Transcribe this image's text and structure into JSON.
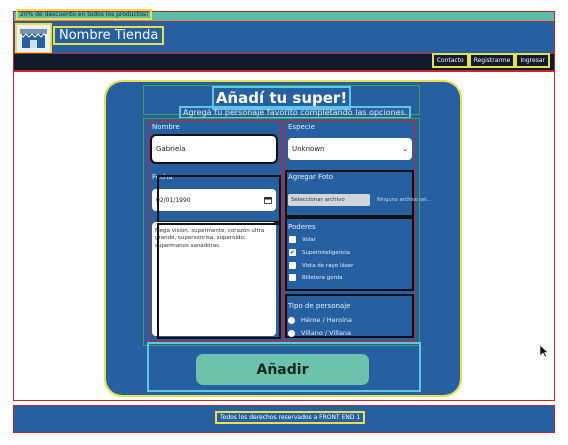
{
  "promo": {
    "text": "20% de descuento en todos los productos!"
  },
  "header": {
    "store_name": "Nombre Tienda",
    "logo_icon": "storefront-icon",
    "nav": [
      "Contacto",
      "Registrarme",
      "Ingresar"
    ]
  },
  "form": {
    "title": "Añadí tu super!",
    "subtitle": "Agregá tu personaje favorito completando las opciones.",
    "name": {
      "label": "Nombre",
      "value": "Gabriela"
    },
    "species": {
      "label": "Especie",
      "value": "Unknown"
    },
    "date": {
      "label": "Fecha",
      "value": "02/01/1990"
    },
    "photo": {
      "label": "Agregar Foto",
      "button": "Seleccionar archivo",
      "file_status": "Ninguno archivo sel..."
    },
    "description": "Mega visión, supermente, corazón ultra grande, supersonrisa, superoído, supermanos sanadoras.",
    "powers": {
      "label": "Poderes",
      "items": [
        {
          "label": "Volar",
          "checked": false
        },
        {
          "label": "Superinteligencia",
          "checked": true
        },
        {
          "label": "Vista de rayo láser",
          "checked": false
        },
        {
          "label": "Billetera gorda",
          "checked": false
        }
      ]
    },
    "character_type": {
      "label": "Tipo de personaje",
      "options": [
        {
          "label": "Héroe / Heroína",
          "selected": true
        },
        {
          "label": "Villano / Villana",
          "selected": false
        }
      ]
    },
    "submit": "Añadir"
  },
  "footer": {
    "text": "Todos los derechos reservados a FRONT END 1"
  },
  "colors": {
    "primary": "#2660a0",
    "accent": "#6cc2ab",
    "promo": "#5bbda8",
    "navbar": "#0f1a2b"
  }
}
